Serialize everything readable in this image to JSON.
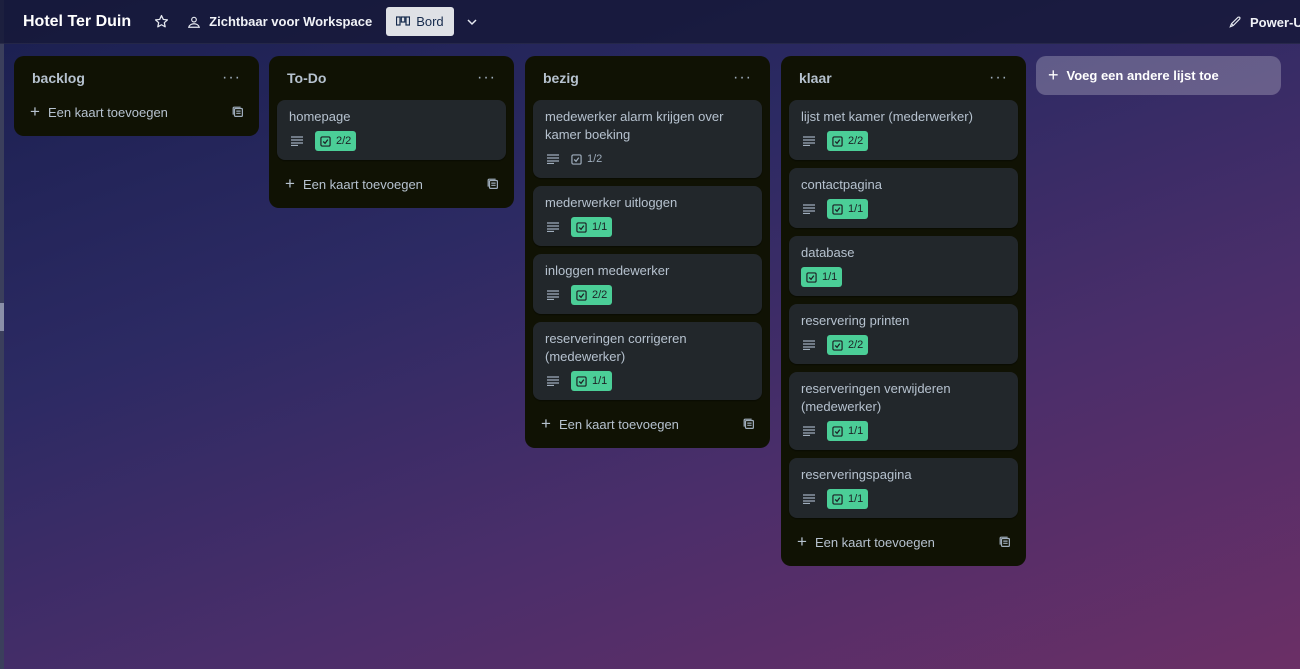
{
  "header": {
    "board_title": "Hotel Ter Duin",
    "visibility_label": "Zichtbaar voor Workspace",
    "view_label": "Bord",
    "powerups_label": "Power-Ups"
  },
  "lists": [
    {
      "title": "backlog",
      "cards": [],
      "add_card_label": "Een kaart toevoegen"
    },
    {
      "title": "To-Do",
      "cards": [
        {
          "title": "homepage",
          "checklist": "2/2",
          "complete": true
        }
      ],
      "add_card_label": "Een kaart toevoegen"
    },
    {
      "title": "bezig",
      "cards": [
        {
          "title": "medewerker alarm krijgen over kamer boeking",
          "checklist": "1/2",
          "complete": false
        },
        {
          "title": "mederwerker uitloggen",
          "checklist": "1/1",
          "complete": true
        },
        {
          "title": "inloggen medewerker",
          "checklist": "2/2",
          "complete": true
        },
        {
          "title": "reserveringen corrigeren (medewerker)",
          "checklist": "1/1",
          "complete": true
        }
      ],
      "add_card_label": "Een kaart toevoegen"
    },
    {
      "title": "klaar",
      "cards": [
        {
          "title": "lijst met kamer (mederwerker)",
          "checklist": "2/2",
          "complete": true
        },
        {
          "title": "contactpagina",
          "checklist": "1/1",
          "complete": true
        },
        {
          "title": "database",
          "checklist": "1/1",
          "complete": true
        },
        {
          "title": "reservering printen",
          "checklist": "2/2",
          "complete": true
        },
        {
          "title": "reserveringen verwijderen (medewerker)",
          "checklist": "1/1",
          "complete": true
        },
        {
          "title": "reserveringspagina",
          "checklist": "1/1",
          "complete": true
        }
      ],
      "add_card_label": "Een kaart toevoegen"
    }
  ],
  "add_list_label": "Voeg een andere lijst toe",
  "colors": {
    "list_bg": "#101204",
    "card_bg": "#22272b",
    "checklist_done": "#4bce97"
  }
}
